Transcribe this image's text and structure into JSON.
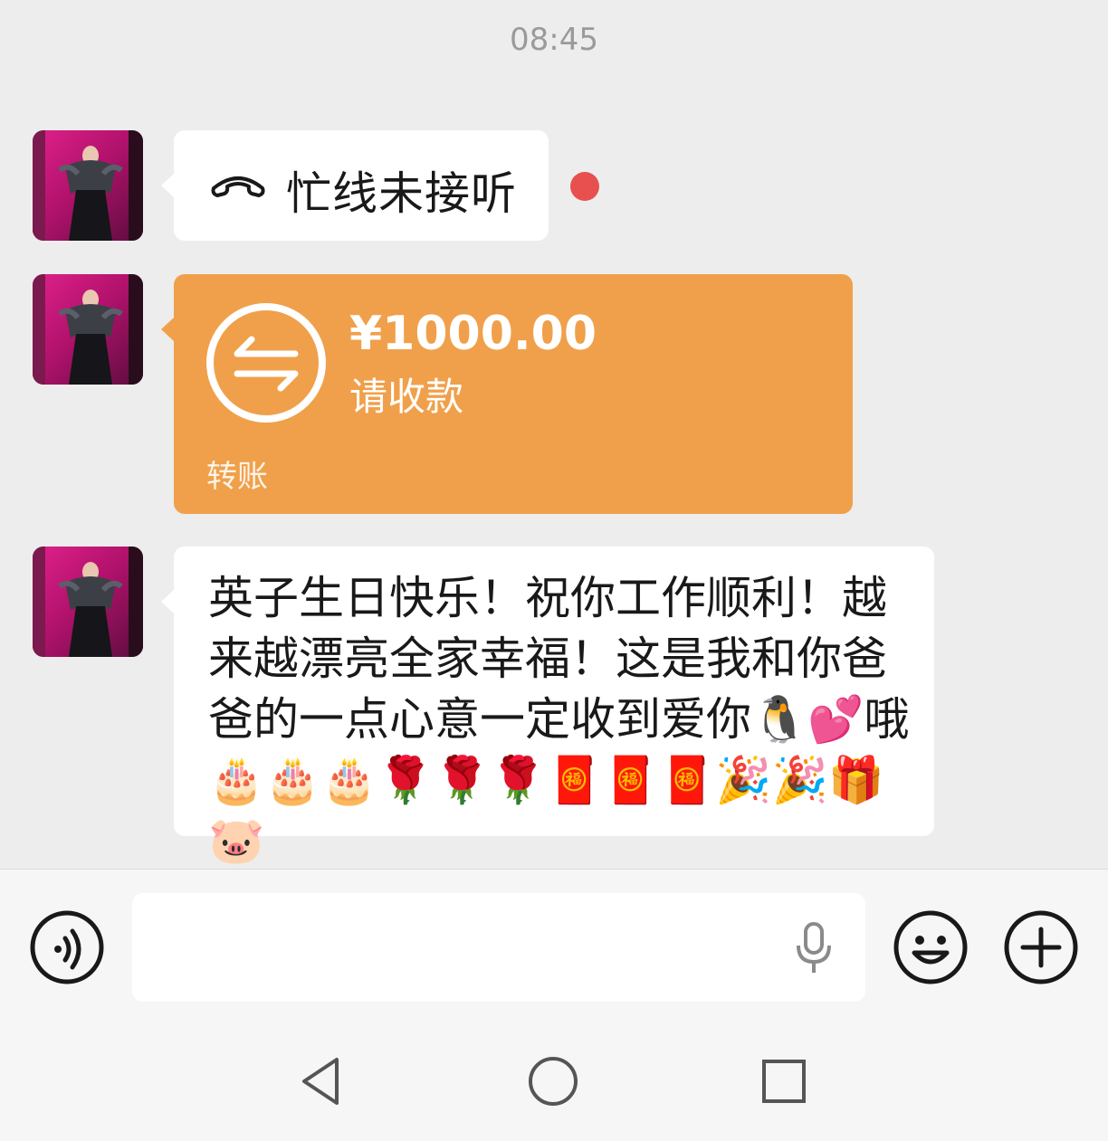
{
  "status_time": "08:45",
  "messages": [
    {
      "type": "call",
      "icon": "hangup-phone-icon",
      "text": "忙线未接听",
      "unread": true
    },
    {
      "type": "transfer",
      "icon": "transfer-arrows-icon",
      "amount": "¥1000.00",
      "status": "请收款",
      "label": "转账"
    },
    {
      "type": "text",
      "text": "英子生日快乐！祝你工作顺利！越来越漂亮全家幸福！这是我和你爸爸的一点心意一定收到爱你🐧💕哦🎂🎂🎂🌹🌹🌹🧧🧧🧧🎉🎉🎁🐷"
    }
  ],
  "input_bar": {
    "voice_button_icon": "voice-input-icon",
    "text_value": "",
    "mic_icon": "microphone-icon",
    "emoji_button_icon": "emoji-icon",
    "more_button_icon": "plus-icon"
  },
  "nav_bar": {
    "back_icon": "back-triangle-icon",
    "home_icon": "home-circle-icon",
    "recents_icon": "recents-square-icon"
  },
  "colors": {
    "background": "#ededed",
    "transfer_bubble": "#f0a04b",
    "unread_dot": "#e84f4f"
  }
}
